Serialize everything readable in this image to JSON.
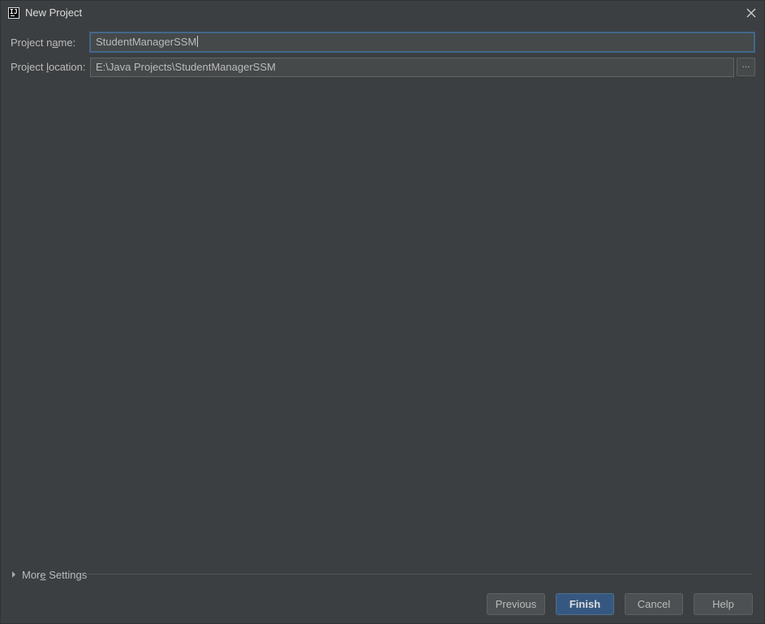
{
  "window": {
    "title": "New Project",
    "app_icon_text": "IJ"
  },
  "form": {
    "project_name": {
      "label_pre": "Project n",
      "label_mnemonic": "a",
      "label_post": "me:",
      "value": "StudentManagerSSM"
    },
    "project_location": {
      "label_pre": "Project ",
      "label_mnemonic": "l",
      "label_post": "ocation:",
      "value": "E:\\Java Projects\\StudentManagerSSM",
      "browse_label": "..."
    }
  },
  "more_settings": {
    "label_pre": "Mor",
    "label_mnemonic": "e",
    "label_post": " Settings"
  },
  "buttons": {
    "previous": "Previous",
    "finish": "Finish",
    "cancel": "Cancel",
    "help": "Help"
  },
  "colors": {
    "background": "#3c3f41",
    "field_background": "#45494a",
    "focus_border": "#466d94",
    "default_button": "#365880"
  },
  "icons": {
    "app": "intellij-idea-icon",
    "close": "close-icon",
    "expand": "triangle-right-icon"
  }
}
